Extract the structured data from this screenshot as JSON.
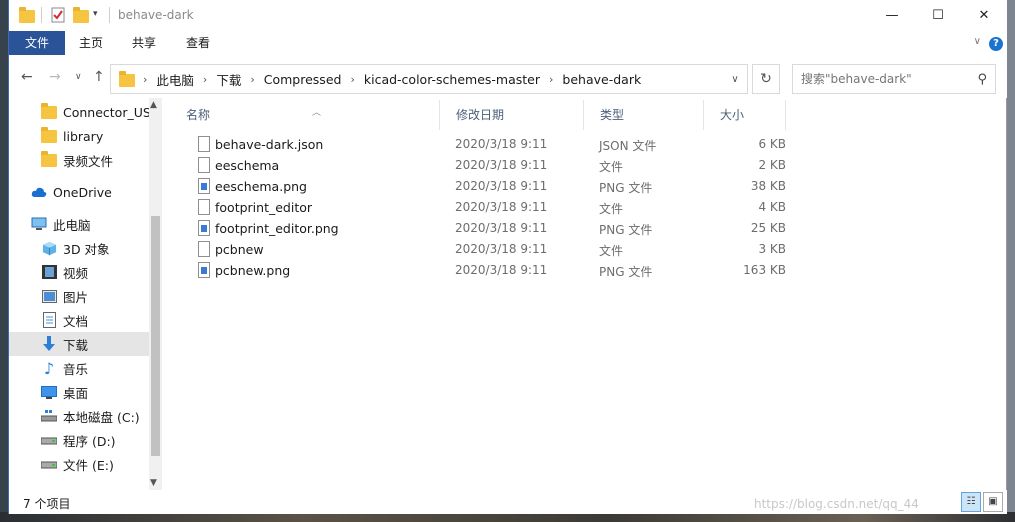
{
  "window": {
    "title": "behave-dark"
  },
  "window_controls": {
    "minimize": "—",
    "maximize": "☐",
    "close": "✕"
  },
  "ribbon": {
    "tabs": [
      "文件",
      "主页",
      "共享",
      "查看"
    ],
    "help": "?",
    "collapse": "∨"
  },
  "nav": {
    "back": "←",
    "forward": "→",
    "recent": "∨",
    "up": "↑",
    "refresh": "↻",
    "dropdown": "∨"
  },
  "breadcrumbs": [
    "此电脑",
    "下载",
    "Compressed",
    "kicad-color-schemes-master",
    "behave-dark"
  ],
  "crumb_separator": "›",
  "search": {
    "placeholder": "搜索\"behave-dark\""
  },
  "sidebar": {
    "items": [
      {
        "label": "Connector_USB",
        "icon": "folder-icon"
      },
      {
        "label": "library",
        "icon": "folder-icon"
      },
      {
        "label": "录频文件",
        "icon": "folder-icon"
      },
      {
        "label": "OneDrive",
        "icon": "cloud-icon"
      },
      {
        "label": "此电脑",
        "icon": "computer-icon"
      },
      {
        "label": "3D 对象",
        "icon": "cube-icon"
      },
      {
        "label": "视频",
        "icon": "video-icon"
      },
      {
        "label": "图片",
        "icon": "picture-icon"
      },
      {
        "label": "文档",
        "icon": "document-icon"
      },
      {
        "label": "下载",
        "icon": "download-icon"
      },
      {
        "label": "音乐",
        "icon": "music-icon"
      },
      {
        "label": "桌面",
        "icon": "desktop-icon"
      },
      {
        "label": "本地磁盘 (C:)",
        "icon": "drive-icon"
      },
      {
        "label": "程序 (D:)",
        "icon": "drive-icon"
      },
      {
        "label": "文件 (E:)",
        "icon": "drive-icon"
      }
    ]
  },
  "columns": {
    "name": "名称",
    "modified": "修改日期",
    "type": "类型",
    "size": "大小"
  },
  "files": [
    {
      "name": "behave-dark.json",
      "modified": "2020/3/18 9:11",
      "type": "JSON 文件",
      "size": "6 KB",
      "icon": "file-icon"
    },
    {
      "name": "eeschema",
      "modified": "2020/3/18 9:11",
      "type": "文件",
      "size": "2 KB",
      "icon": "file-icon"
    },
    {
      "name": "eeschema.png",
      "modified": "2020/3/18 9:11",
      "type": "PNG 文件",
      "size": "38 KB",
      "icon": "image-file-icon"
    },
    {
      "name": "footprint_editor",
      "modified": "2020/3/18 9:11",
      "type": "文件",
      "size": "4 KB",
      "icon": "file-icon"
    },
    {
      "name": "footprint_editor.png",
      "modified": "2020/3/18 9:11",
      "type": "PNG 文件",
      "size": "25 KB",
      "icon": "image-file-icon"
    },
    {
      "name": "pcbnew",
      "modified": "2020/3/18 9:11",
      "type": "文件",
      "size": "3 KB",
      "icon": "file-icon"
    },
    {
      "name": "pcbnew.png",
      "modified": "2020/3/18 9:11",
      "type": "PNG 文件",
      "size": "163 KB",
      "icon": "image-file-icon"
    }
  ],
  "status": {
    "item_count": "7 个项目"
  },
  "watermark": "https://blog.csdn.net/qq_44",
  "colors": {
    "accent": "#2a5497",
    "selection": "#cce4f7",
    "folder": "#f5c542"
  }
}
